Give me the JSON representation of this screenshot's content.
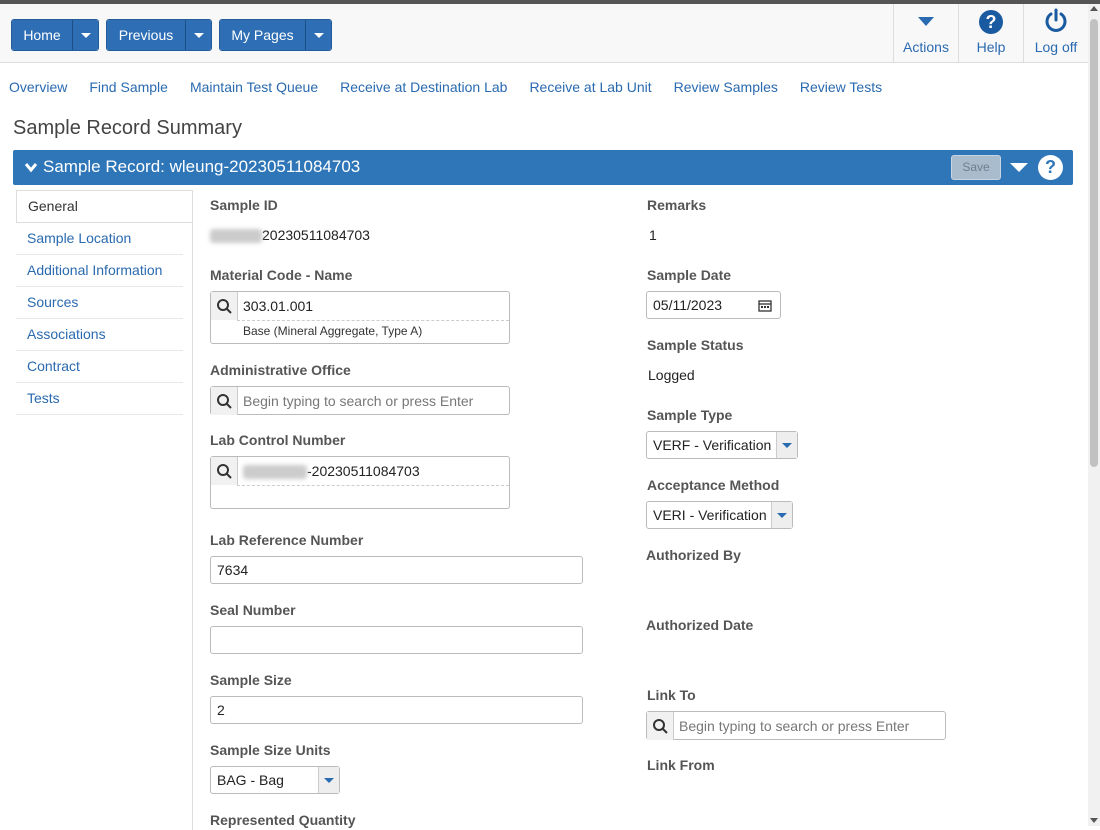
{
  "toolbar": {
    "home_label": "Home",
    "previous_label": "Previous",
    "mypages_label": "My Pages",
    "actions_label": "Actions",
    "help_label": "Help",
    "logoff_label": "Log off"
  },
  "nav": {
    "links": [
      "Overview",
      "Find Sample",
      "Maintain Test Queue",
      "Receive at Destination Lab",
      "Receive at Lab Unit",
      "Review Samples",
      "Review Tests"
    ]
  },
  "page": {
    "title": "Sample Record Summary"
  },
  "section": {
    "title": "Sample Record: wleung-20230511084703",
    "save_label": "Save",
    "help_glyph": "?"
  },
  "sidebar": {
    "items": [
      "General",
      "Sample Location",
      "Additional Information",
      "Sources",
      "Associations",
      "Contract",
      "Tests"
    ],
    "active": "General"
  },
  "form": {
    "sample_id": {
      "label": "Sample ID",
      "value": "20230511084703"
    },
    "material_code": {
      "label": "Material Code - Name",
      "value": "303.01.001",
      "description": "Base (Mineral Aggregate, Type A)"
    },
    "admin_office": {
      "label": "Administrative Office",
      "placeholder": "Begin typing to search or press Enter"
    },
    "lab_control": {
      "label": "Lab Control Number",
      "value": "-20230511084703"
    },
    "lab_reference": {
      "label": "Lab Reference Number",
      "value": "7634"
    },
    "seal_number": {
      "label": "Seal Number",
      "value": ""
    },
    "sample_size": {
      "label": "Sample Size",
      "value": "2"
    },
    "sample_size_units": {
      "label": "Sample Size Units",
      "value": "BAG - Bag"
    },
    "represented_quantity": {
      "label": "Represented Quantity"
    },
    "remarks": {
      "label": "Remarks",
      "value": "1"
    },
    "sample_date": {
      "label": "Sample Date",
      "value": "05/11/2023"
    },
    "sample_status": {
      "label": "Sample Status",
      "value": "Logged"
    },
    "sample_type": {
      "label": "Sample Type",
      "value": "VERF - Verification"
    },
    "acceptance_method": {
      "label": "Acceptance Method",
      "value": "VERI - Verification"
    },
    "authorized_by": {
      "label": "Authorized By"
    },
    "authorized_date": {
      "label": "Authorized Date"
    },
    "link_to": {
      "label": "Link To",
      "placeholder": "Begin typing to search or press Enter"
    },
    "link_from": {
      "label": "Link From"
    }
  },
  "colors": {
    "primary": "#2e76b8",
    "link": "#2a6ab0"
  },
  "icons": [
    "chevron-down-icon",
    "actions-caret-icon",
    "help-icon",
    "power-icon",
    "search-icon",
    "calendar-icon"
  ]
}
